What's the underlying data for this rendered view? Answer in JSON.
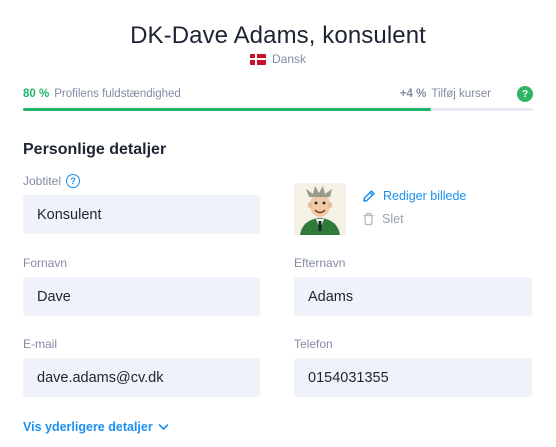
{
  "header": {
    "title": "DK-Dave Adams, konsulent",
    "language": "Dansk",
    "language_icon": "danish-flag-icon"
  },
  "progress": {
    "percent_label": "80 %",
    "percent_value": 0.8,
    "label": "Profilens fuldstændighed",
    "gain_label": "+4 %",
    "gain_action": "Tilføj kurser",
    "help_symbol": "?",
    "fill_color": "#21b36a"
  },
  "section": {
    "title": "Personlige detaljer"
  },
  "fields": {
    "job_title": {
      "label": "Jobtitel",
      "value": "Konsulent",
      "info_symbol": "?"
    },
    "first_name": {
      "label": "Fornavn",
      "value": "Dave"
    },
    "last_name": {
      "label": "Efternavn",
      "value": "Adams"
    },
    "email": {
      "label": "E-mail",
      "value": "dave.adams@cv.dk"
    },
    "phone": {
      "label": "Telefon",
      "value": "0154031355"
    }
  },
  "photo": {
    "edit_label": "Rediger billede",
    "delete_label": "Slet"
  },
  "more": {
    "label": "Vis yderligere detaljer"
  },
  "colors": {
    "accent": "#1a91f0",
    "success": "#21b36a",
    "input_bg": "#eff2f9",
    "muted": "#828ba2"
  }
}
